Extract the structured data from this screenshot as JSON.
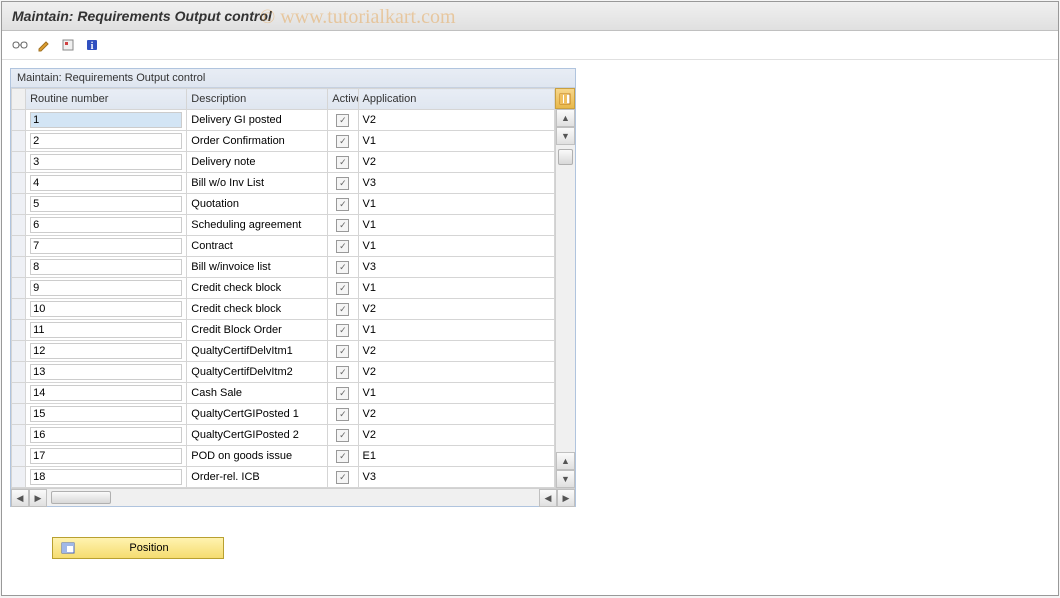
{
  "title": "Maintain: Requirements Output control",
  "table_title": "Maintain: Requirements Output control",
  "columns": {
    "routine": "Routine number",
    "description": "Description",
    "active": "Active",
    "application": "Application"
  },
  "rows": [
    {
      "routine": "1",
      "description": "Delivery GI posted",
      "active": true,
      "application": "V2",
      "selected": true
    },
    {
      "routine": "2",
      "description": "Order Confirmation",
      "active": true,
      "application": "V1"
    },
    {
      "routine": "3",
      "description": "Delivery note",
      "active": true,
      "application": "V2"
    },
    {
      "routine": "4",
      "description": "Bill w/o Inv List",
      "active": true,
      "application": "V3"
    },
    {
      "routine": "5",
      "description": "Quotation",
      "active": true,
      "application": "V1"
    },
    {
      "routine": "6",
      "description": "Scheduling agreement",
      "active": true,
      "application": "V1"
    },
    {
      "routine": "7",
      "description": "Contract",
      "active": true,
      "application": "V1"
    },
    {
      "routine": "8",
      "description": "Bill w/invoice list",
      "active": true,
      "application": "V3"
    },
    {
      "routine": "9",
      "description": "Credit check block",
      "active": true,
      "application": "V1"
    },
    {
      "routine": "10",
      "description": "Credit check block",
      "active": true,
      "application": "V2"
    },
    {
      "routine": "11",
      "description": "Credit Block Order",
      "active": true,
      "application": "V1"
    },
    {
      "routine": "12",
      "description": "QualtyCertifDelvItm1",
      "active": true,
      "application": "V2"
    },
    {
      "routine": "13",
      "description": "QualtyCertifDelvItm2",
      "active": true,
      "application": "V2"
    },
    {
      "routine": "14",
      "description": "Cash Sale",
      "active": true,
      "application": "V1"
    },
    {
      "routine": "15",
      "description": "QualtyCertGIPosted 1",
      "active": true,
      "application": "V2"
    },
    {
      "routine": "16",
      "description": "QualtyCertGIPosted 2",
      "active": true,
      "application": "V2"
    },
    {
      "routine": "17",
      "description": "POD on goods issue",
      "active": true,
      "application": "E1"
    },
    {
      "routine": "18",
      "description": "Order-rel. ICB",
      "active": true,
      "application": "V3"
    }
  ],
  "position_button": "Position",
  "watermark": "© www.tutorialkart.com"
}
